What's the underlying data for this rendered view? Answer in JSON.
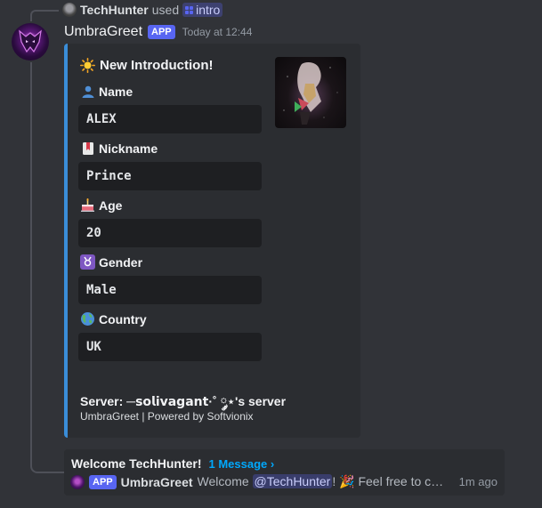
{
  "command_usage": {
    "user": "TechHunter",
    "used_text": "used",
    "command": "intro"
  },
  "message": {
    "author": "UmbraGreet",
    "badge": "APP",
    "timestamp": "Today at 12:44"
  },
  "embed": {
    "accent_color": "#3a8dd8",
    "title": "New Introduction!",
    "title_icon": "sun-icon",
    "fields": [
      {
        "name": "Name",
        "icon": "bust-silhouette-icon",
        "value": "ALEX"
      },
      {
        "name": "Nickname",
        "icon": "bookmark-icon",
        "value": "Prince"
      },
      {
        "name": "Age",
        "icon": "birthday-cake-icon",
        "value": "20"
      },
      {
        "name": "Gender",
        "icon": "gender-symbol-icon",
        "value": "Male"
      },
      {
        "name": "Country",
        "icon": "globe-icon",
        "value": "UK"
      }
    ],
    "server_text": "Server: ─𝘀𝗼𝗹𝗶𝘃𝗮𝗴𝗮𝗻𝘁·˚ ༘⋆'s server",
    "footer": "UmbraGreet | Powered by Softvionix"
  },
  "thread": {
    "title": "Welcome TechHunter!",
    "message_count_link": "1 Message ›",
    "last_author": "UmbraGreet",
    "last_author_badge": "APP",
    "preview_prefix": "Welcome",
    "mention": "@TechHunter",
    "preview_suffix": "! 🎉 Feel free to chat ...",
    "time": "1m ago"
  }
}
